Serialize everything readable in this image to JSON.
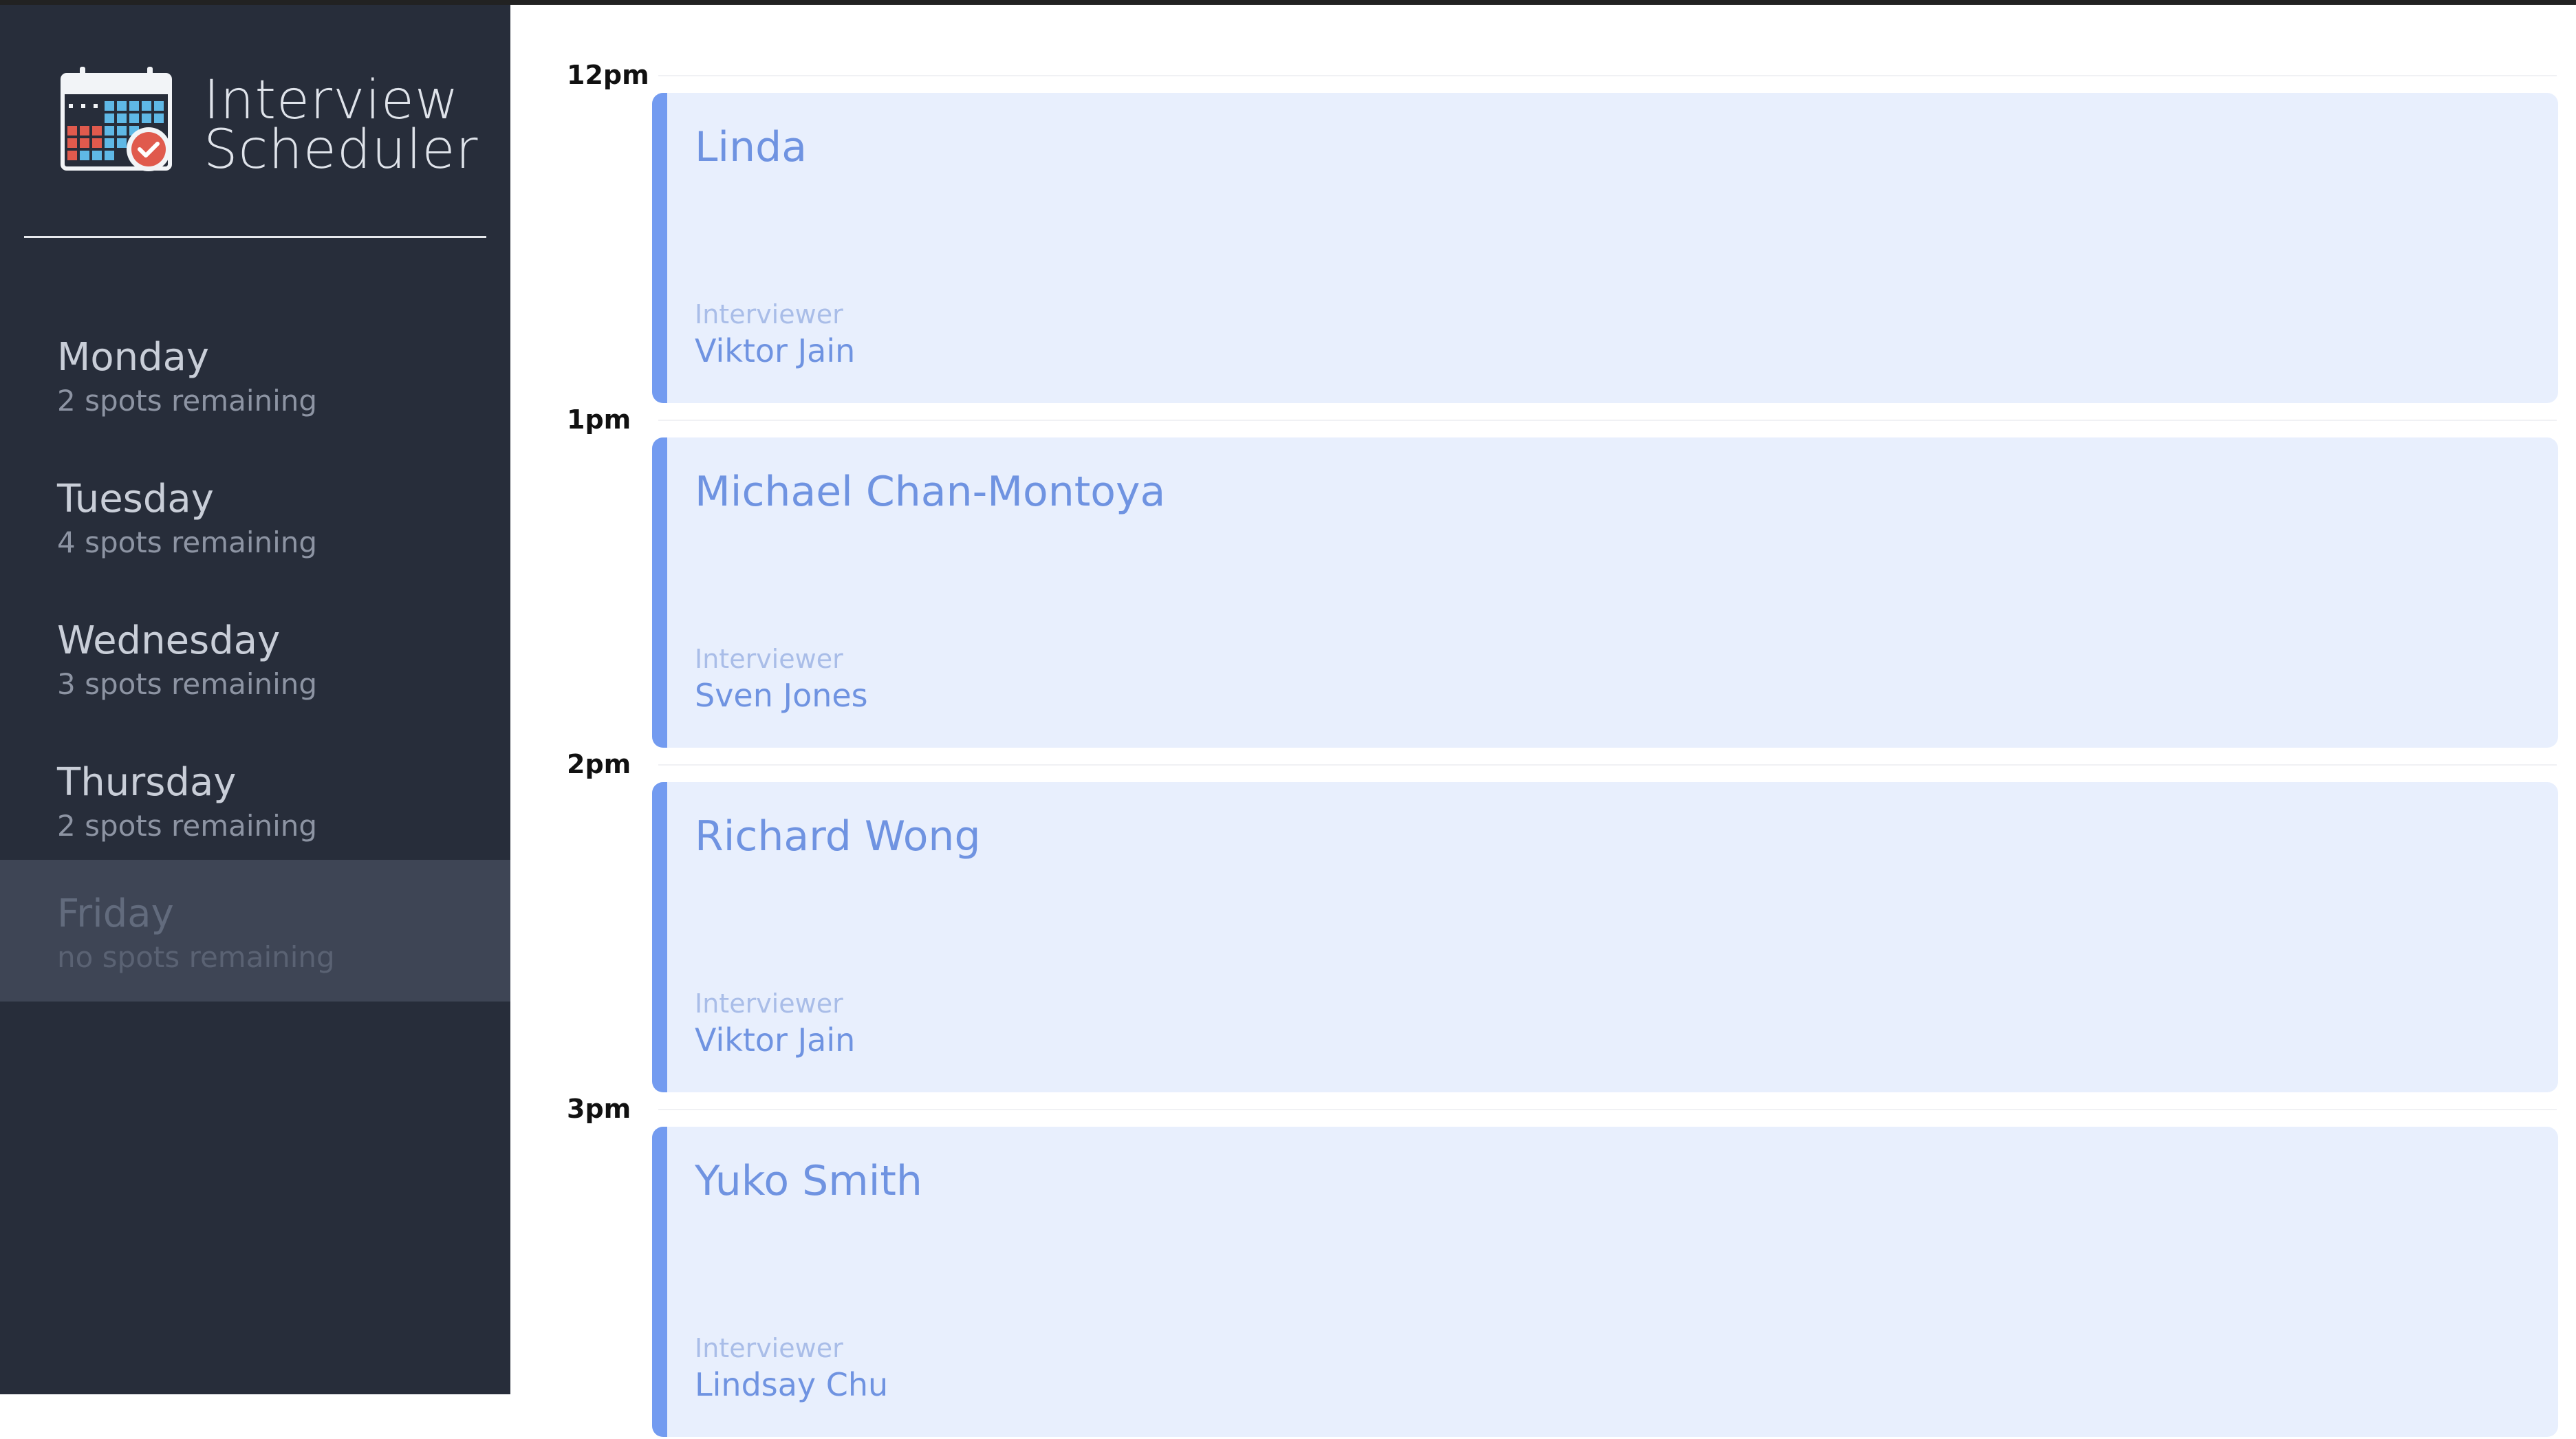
{
  "app": {
    "title_line1": "Interview",
    "title_line2": "Scheduler"
  },
  "sidebar": {
    "days": [
      {
        "name": "Monday",
        "spots": "2 spots remaining",
        "selected": false
      },
      {
        "name": "Tuesday",
        "spots": "4 spots remaining",
        "selected": false
      },
      {
        "name": "Wednesday",
        "spots": "3 spots remaining",
        "selected": false
      },
      {
        "name": "Thursday",
        "spots": "2 spots remaining",
        "selected": false
      },
      {
        "name": "Friday",
        "spots": "no spots remaining",
        "selected": true
      }
    ]
  },
  "schedule": {
    "interviewer_label": "Interviewer",
    "slots": [
      {
        "time": "12pm",
        "student": "Linda",
        "interviewer": "Viktor Jain"
      },
      {
        "time": "1pm",
        "student": "Michael Chan-Montoya",
        "interviewer": "Sven Jones"
      },
      {
        "time": "2pm",
        "student": "Richard Wong",
        "interviewer": "Viktor Jain"
      },
      {
        "time": "3pm",
        "student": "Yuko Smith",
        "interviewer": "Lindsay Chu"
      }
    ]
  },
  "colors": {
    "sidebar_bg": "#272d3a",
    "selected_day_bg": "#3e4555",
    "card_bg": "#e8effd",
    "accent": "#739bf0"
  },
  "icons": {
    "logo": "calendar-check-icon"
  }
}
